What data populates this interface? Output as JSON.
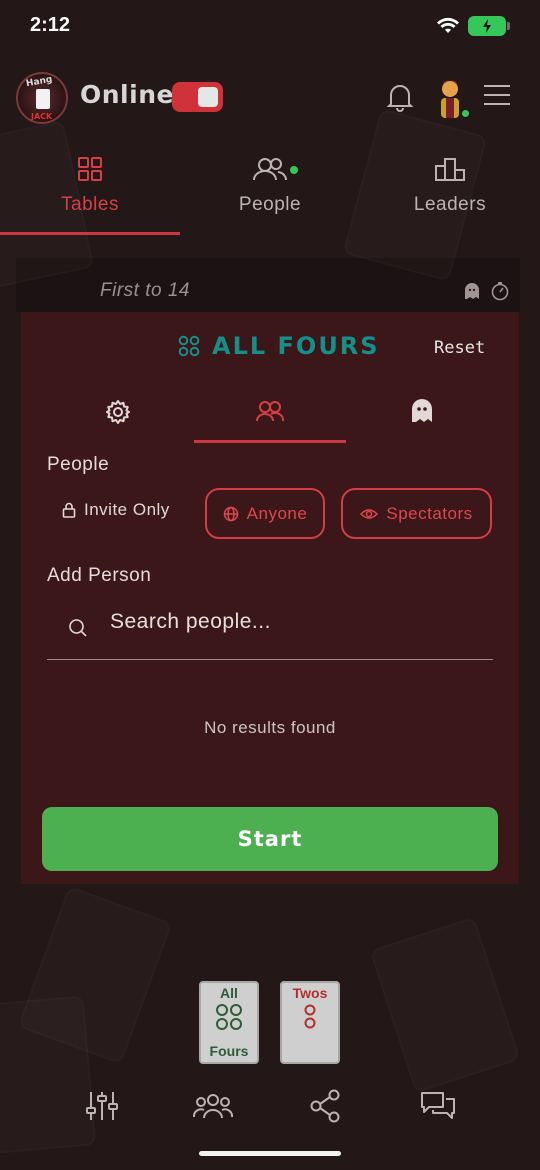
{
  "status": {
    "time": "2:12"
  },
  "header": {
    "mode_label": "Online",
    "logo_text_top": "Hang",
    "logo_text_bottom": "JACK"
  },
  "tabs": [
    {
      "label": "Tables",
      "icon": "grid-icon",
      "active": true
    },
    {
      "label": "People",
      "icon": "people-icon",
      "active": false
    },
    {
      "label": "Leaders",
      "icon": "podium-icon",
      "active": false
    }
  ],
  "table": {
    "first_to": "First to 14",
    "game_name": "ALL FOURS",
    "reset_label": "Reset"
  },
  "people_section": {
    "label": "People",
    "invite_only": "Invite Only",
    "anyone": "Anyone",
    "spectators": "Spectators"
  },
  "add_person": {
    "label": "Add Person",
    "placeholder": "Search people...",
    "no_results": "No results found"
  },
  "start_label": "Start",
  "game_cards": [
    {
      "top": "All",
      "bottom": "Fours",
      "color": "#2f5b39"
    },
    {
      "top": "Twos",
      "bottom": "",
      "color": "#b03030"
    }
  ],
  "colors": {
    "accent_red": "#d23d46",
    "teal": "#158f8a",
    "green": "#4caf50"
  }
}
